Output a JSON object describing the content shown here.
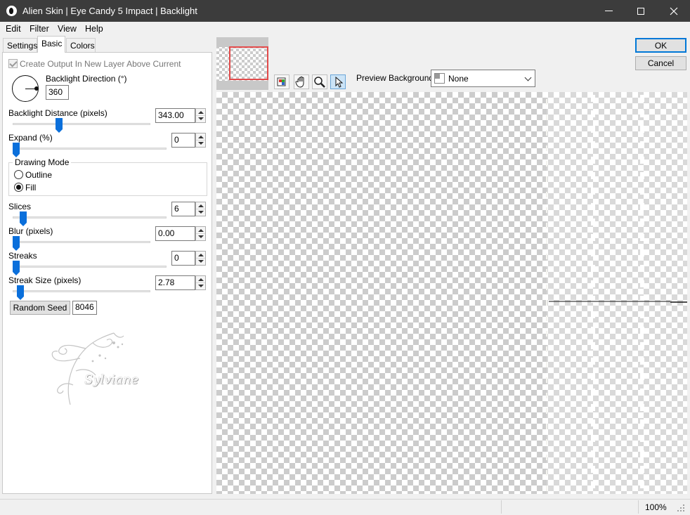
{
  "window": {
    "title": "Alien Skin | Eye Candy 5 Impact | Backlight"
  },
  "menu": {
    "items": [
      {
        "label": "Edit"
      },
      {
        "label": "Filter"
      },
      {
        "label": "View"
      },
      {
        "label": "Help"
      }
    ]
  },
  "tabs": [
    {
      "label": "Settings",
      "active": false
    },
    {
      "label": "Basic",
      "active": true
    },
    {
      "label": "Colors",
      "active": false
    }
  ],
  "basic": {
    "create_output_label": "Create Output In New Layer Above Current",
    "create_output_checked": true,
    "backlight_direction": {
      "label": "Backlight Direction (°)",
      "value": "360"
    },
    "backlight_distance": {
      "label": "Backlight Distance (pixels)",
      "value": "343.00",
      "level": 0.33
    },
    "expand": {
      "label": "Expand (%)",
      "value": "0",
      "level": 0.0
    },
    "drawing_mode": {
      "label": "Drawing Mode",
      "options": [
        {
          "label": "Outline",
          "selected": false
        },
        {
          "label": "Fill",
          "selected": true
        }
      ]
    },
    "slices": {
      "label": "Slices",
      "value": "6",
      "level": 0.05
    },
    "blur": {
      "label": "Blur (pixels)",
      "value": "0.00",
      "level": 0.0
    },
    "streaks": {
      "label": "Streaks",
      "value": "0",
      "level": 0.0
    },
    "streak_size": {
      "label": "Streak Size (pixels)",
      "value": "2.78",
      "level": 0.03
    },
    "random_seed": {
      "button_label": "Random Seed",
      "value": "8046"
    }
  },
  "preview": {
    "tools": [
      {
        "icon": "preview-toggle-icon"
      },
      {
        "icon": "hand-pan-icon"
      },
      {
        "icon": "zoom-magnifier-icon"
      },
      {
        "icon": "arrow-select-icon",
        "active": true
      }
    ],
    "background_label": "Preview Background:",
    "background_value": "None"
  },
  "buttons": {
    "ok": "OK",
    "cancel": "Cancel"
  },
  "status": {
    "zoom": "100%"
  },
  "watermark": {
    "text": "Sylviane"
  }
}
